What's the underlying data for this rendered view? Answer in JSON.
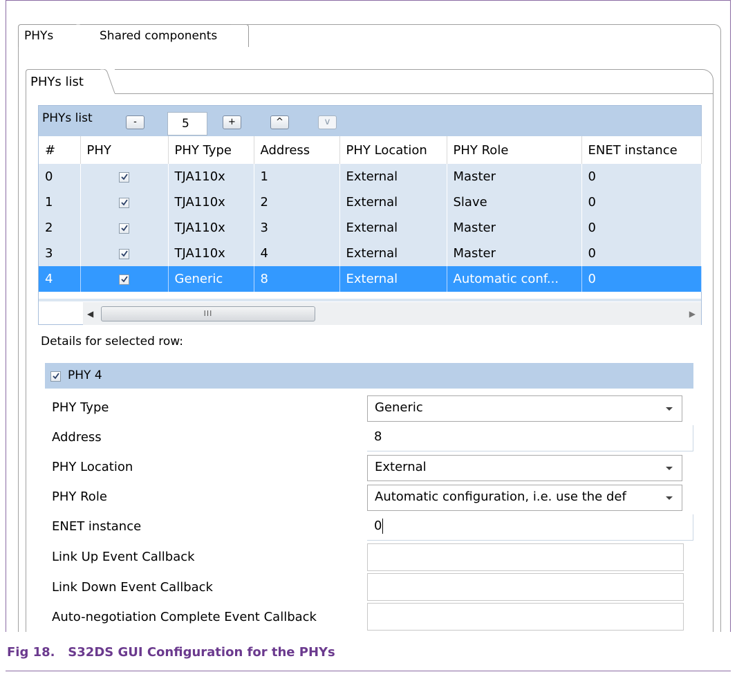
{
  "outer_tabs": [
    "PHYs",
    "Shared components"
  ],
  "inner_tab": "PHYs list",
  "list_toolbar": {
    "label": "PHYs list",
    "minus_label": "-",
    "count": "5",
    "plus_label": "+",
    "up_label": "^",
    "down_label": "v"
  },
  "table": {
    "columns": [
      "#",
      "PHY",
      "PHY Type",
      "Address",
      "PHY Location",
      "PHY Role",
      "ENET instance"
    ],
    "rows": [
      {
        "index": "0",
        "phy_checked": true,
        "type": "TJA110x",
        "address": "1",
        "location": "External",
        "role": "Master",
        "enet": "0"
      },
      {
        "index": "1",
        "phy_checked": true,
        "type": "TJA110x",
        "address": "2",
        "location": "External",
        "role": "Slave",
        "enet": "0"
      },
      {
        "index": "2",
        "phy_checked": true,
        "type": "TJA110x",
        "address": "3",
        "location": "External",
        "role": "Master",
        "enet": "0"
      },
      {
        "index": "3",
        "phy_checked": true,
        "type": "TJA110x",
        "address": "4",
        "location": "External",
        "role": "Master",
        "enet": "0"
      },
      {
        "index": "4",
        "phy_checked": true,
        "type": "Generic",
        "address": "8",
        "location": "External",
        "role": "Automatic conf...",
        "enet": "0",
        "selected": true
      }
    ]
  },
  "scrollbar": {
    "left_arrow": "◀",
    "thumb_grip": "III",
    "right_arrow": "▶"
  },
  "details": {
    "label": "Details for selected row:",
    "header": "PHY 4",
    "fields": {
      "phy_type": {
        "label": "PHY Type",
        "value": "Generic"
      },
      "address": {
        "label": "Address",
        "value": "8"
      },
      "phy_location": {
        "label": "PHY Location",
        "value": "External"
      },
      "phy_role": {
        "label": "PHY Role",
        "value": "Automatic configuration, i.e. use the def"
      },
      "enet_instance": {
        "label": "ENET instance",
        "value": "0"
      },
      "link_up": {
        "label": "Link Up Event Callback",
        "value": ""
      },
      "link_down": {
        "label": "Link Down Event Callback",
        "value": ""
      },
      "autoneg": {
        "label": "Auto-negotiation Complete Event Callback",
        "value": ""
      }
    }
  },
  "caption": "Fig 18.   S32DS GUI Configuration for the PHYs",
  "colors": {
    "selection": "#3399ff",
    "header_band": "#b9cfe8",
    "row_bg": "#dbe6f2",
    "caption": "#6b3a8e"
  }
}
